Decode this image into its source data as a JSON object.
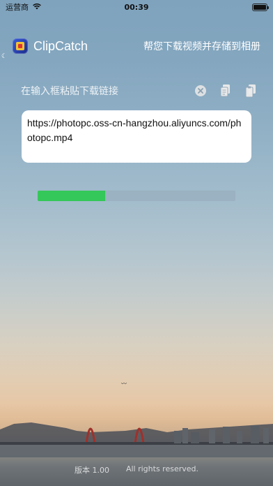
{
  "status_bar": {
    "carrier": "运营商",
    "time": "00:39"
  },
  "header": {
    "app_title": "ClipCatch",
    "subtitle": "帮您下载视频并存储到相册"
  },
  "input": {
    "placeholder": "在输入框粘贴下载链接"
  },
  "url_box": {
    "text": "https://photopc.oss-cn-hangzhou.aliyuncs.com/photopc.mp4"
  },
  "progress": {
    "fraction": 0.34,
    "color": "#34c759"
  },
  "footer": {
    "version": "版本 1.00",
    "rights": "All rights reserved."
  },
  "icons": [
    "wifi-icon",
    "battery-icon",
    "clear-icon",
    "paste-icon",
    "copy-icon"
  ]
}
